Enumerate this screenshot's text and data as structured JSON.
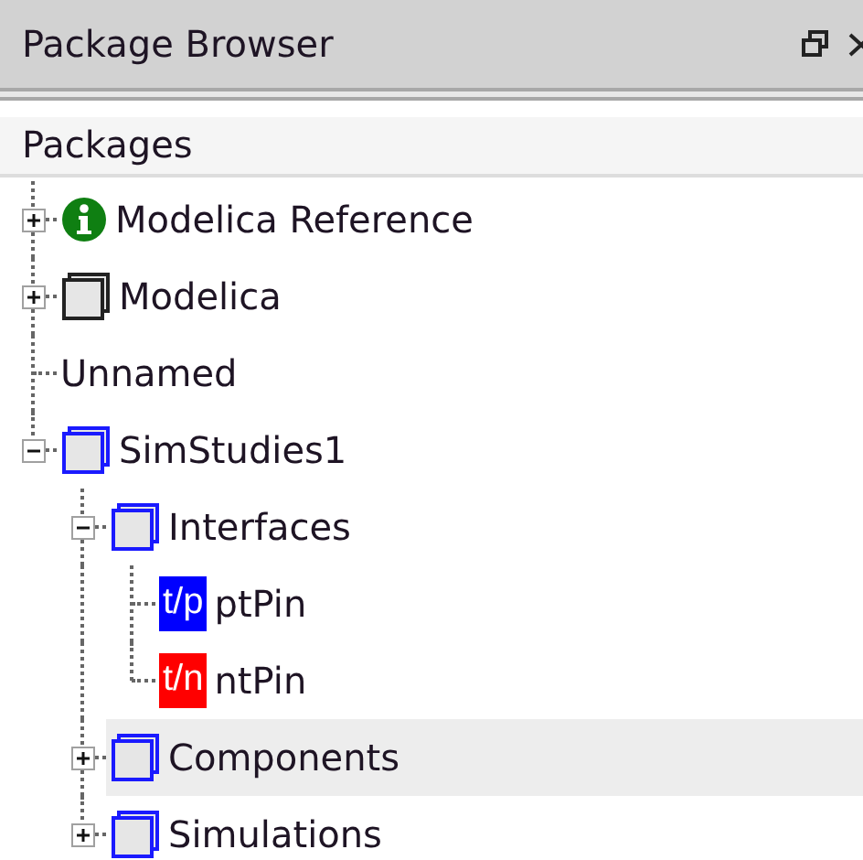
{
  "window": {
    "title": "Package Browser"
  },
  "header": "Packages",
  "tree": [
    {
      "label": "Modelica Reference",
      "kind": "info",
      "expanded": false,
      "highlighted": false
    },
    {
      "label": "Modelica",
      "kind": "library",
      "expanded": false,
      "highlighted": false
    },
    {
      "label": "Unnamed",
      "kind": "plain",
      "highlighted": false
    },
    {
      "label": "SimStudies1",
      "kind": "package",
      "expanded": true,
      "highlighted": false,
      "children": [
        {
          "label": "Interfaces",
          "kind": "package",
          "expanded": true,
          "highlighted": false,
          "children": [
            {
              "label": "ptPin",
              "kind": "connector",
              "badge": "t/p",
              "color": "#0000ff",
              "highlighted": false
            },
            {
              "label": "ntPin",
              "kind": "connector",
              "badge": "t/n",
              "color": "#ff0000",
              "highlighted": false
            }
          ]
        },
        {
          "label": "Components",
          "kind": "package",
          "expanded": false,
          "highlighted": true
        },
        {
          "label": "Simulations",
          "kind": "package",
          "expanded": false,
          "highlighted": false
        }
      ]
    }
  ]
}
